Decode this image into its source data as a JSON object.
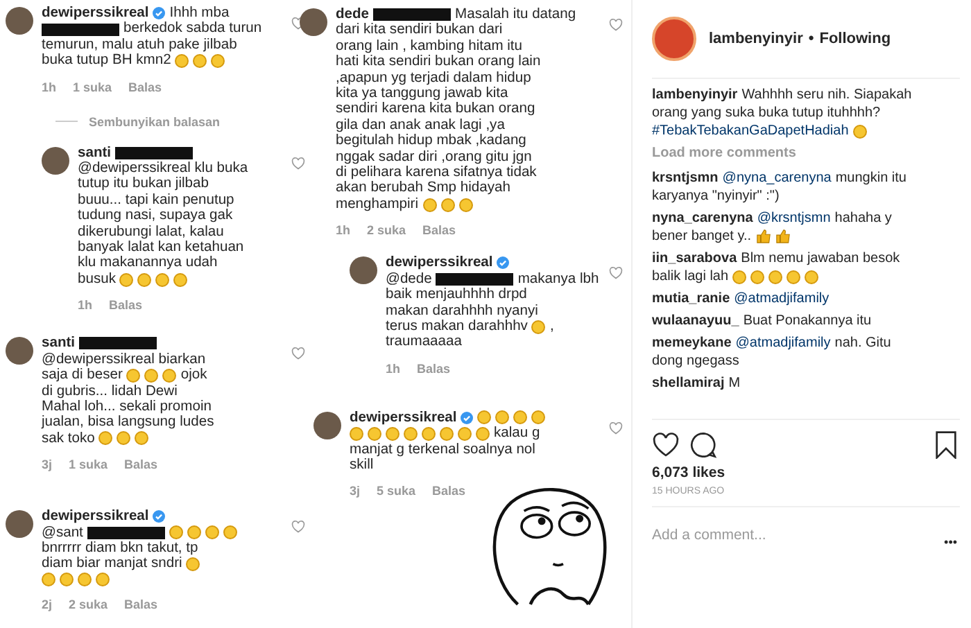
{
  "left_column": {
    "comments": [
      {
        "user": "dewiperssikreal",
        "verified": true,
        "redacted_name": false,
        "head": [
          {
            "kind": "text",
            "text": "Ihhh mba"
          }
        ],
        "lines": [
          [
            {
              "kind": "redacted"
            },
            {
              "kind": "text",
              "text": "berkedok sabda turun"
            }
          ],
          [
            {
              "kind": "text",
              "text": "temurun, malu atuh pake jilbab"
            }
          ],
          [
            {
              "kind": "text",
              "text": "buka tutup BH kmn2"
            },
            {
              "kind": "emoji"
            },
            {
              "kind": "emoji"
            },
            {
              "kind": "emoji"
            }
          ]
        ],
        "time": "1h",
        "likes": "1 suka",
        "reply": "Balas",
        "replies_toggle": "Sembunyikan balasan",
        "children": [
          {
            "user": "santi",
            "verified": false,
            "redacted_name": true,
            "lines": [
              [
                {
                  "kind": "text",
                  "text": "@dewiperssikreal klu buka"
                }
              ],
              [
                {
                  "kind": "text",
                  "text": "tutup itu bukan jilbab"
                }
              ],
              [
                {
                  "kind": "text",
                  "text": "buuu... tapi kain penutup"
                }
              ],
              [
                {
                  "kind": "text",
                  "text": "tudung nasi, supaya gak"
                }
              ],
              [
                {
                  "kind": "text",
                  "text": "dikerubungi lalat, kalau"
                }
              ],
              [
                {
                  "kind": "text",
                  "text": "banyak lalat kan ketahuan"
                }
              ],
              [
                {
                  "kind": "text",
                  "text": "klu makanannya udah"
                }
              ],
              [
                {
                  "kind": "text",
                  "text": "busuk"
                },
                {
                  "kind": "emoji"
                },
                {
                  "kind": "emoji"
                },
                {
                  "kind": "emoji"
                },
                {
                  "kind": "emoji"
                }
              ]
            ],
            "time": "1h",
            "reply": "Balas"
          }
        ]
      },
      {
        "user": "santi",
        "verified": false,
        "redacted_name": true,
        "lines": [
          [
            {
              "kind": "text",
              "text": "@dewiperssikreal biarkan"
            }
          ],
          [
            {
              "kind": "text",
              "text": "saja di beser"
            },
            {
              "kind": "emoji"
            },
            {
              "kind": "emoji"
            },
            {
              "kind": "emoji"
            },
            {
              "kind": "text",
              "text": "ojok"
            }
          ],
          [
            {
              "kind": "text",
              "text": "di gubris... lidah Dewi"
            }
          ],
          [
            {
              "kind": "text",
              "text": "Mahal loh... sekali promoin"
            }
          ],
          [
            {
              "kind": "text",
              "text": "jualan, bisa langsung ludes"
            }
          ],
          [
            {
              "kind": "text",
              "text": "sak toko"
            },
            {
              "kind": "emoji"
            },
            {
              "kind": "emoji"
            },
            {
              "kind": "emoji"
            }
          ]
        ],
        "time": "3j",
        "likes": "1 suka",
        "reply": "Balas"
      },
      {
        "user": "dewiperssikreal",
        "verified": true,
        "redacted_name": false,
        "lines": [
          [
            {
              "kind": "text",
              "text": "@sant"
            },
            {
              "kind": "redacted"
            },
            {
              "kind": "emoji"
            },
            {
              "kind": "emoji"
            },
            {
              "kind": "emoji"
            },
            {
              "kind": "emoji"
            }
          ],
          [
            {
              "kind": "text",
              "text": "bnrrrrr diam bkn takut, tp"
            }
          ],
          [
            {
              "kind": "text",
              "text": "diam biar manjat sndri"
            },
            {
              "kind": "emoji"
            }
          ],
          [
            {
              "kind": "emoji"
            },
            {
              "kind": "emoji"
            },
            {
              "kind": "emoji"
            },
            {
              "kind": "emoji"
            }
          ]
        ],
        "time": "2j",
        "likes": "2 suka",
        "reply": "Balas"
      }
    ]
  },
  "middle_column": {
    "comments": [
      {
        "user": "dede",
        "verified": false,
        "redacted_name": true,
        "head": [
          {
            "kind": "text",
            "text": "Masalah itu datang"
          }
        ],
        "lines": [
          [
            {
              "kind": "text",
              "text": "dari kita sendiri bukan dari"
            }
          ],
          [
            {
              "kind": "text",
              "text": "orang lain , kambing hitam itu"
            }
          ],
          [
            {
              "kind": "text",
              "text": "hati kita sendiri bukan orang lain"
            }
          ],
          [
            {
              "kind": "text",
              "text": ",apapun yg terjadi dalam hidup"
            }
          ],
          [
            {
              "kind": "text",
              "text": "kita ya tanggung jawab kita"
            }
          ],
          [
            {
              "kind": "text",
              "text": "sendiri karena kita bukan orang"
            }
          ],
          [
            {
              "kind": "text",
              "text": "gila dan anak anak lagi ,ya"
            }
          ],
          [
            {
              "kind": "text",
              "text": "begitulah hidup mbak ,kadang"
            }
          ],
          [
            {
              "kind": "text",
              "text": "nggak sadar diri ,orang gitu jgn"
            }
          ],
          [
            {
              "kind": "text",
              "text": "di pelihara karena sifatnya tidak"
            }
          ],
          [
            {
              "kind": "text",
              "text": "akan berubah Smp hidayah"
            }
          ],
          [
            {
              "kind": "text",
              "text": "menghampiri"
            },
            {
              "kind": "emoji"
            },
            {
              "kind": "emoji"
            },
            {
              "kind": "emoji"
            }
          ]
        ],
        "time": "1h",
        "likes": "2 suka",
        "reply": "Balas",
        "children": [
          {
            "user": "dewiperssikreal",
            "verified": true,
            "redacted_name": false,
            "lines": [
              [
                {
                  "kind": "text",
                  "text": "@dede"
                },
                {
                  "kind": "redacted"
                },
                {
                  "kind": "text",
                  "text": "makanya lbh"
                }
              ],
              [
                {
                  "kind": "text",
                  "text": "baik menjauhhhh drpd"
                }
              ],
              [
                {
                  "kind": "text",
                  "text": "makan darahhhh nyanyi"
                }
              ],
              [
                {
                  "kind": "text",
                  "text": "terus makan darahhhv"
                },
                {
                  "kind": "emoji"
                },
                {
                  "kind": "text",
                  "text": ","
                }
              ],
              [
                {
                  "kind": "text",
                  "text": "traumaaaaa"
                }
              ]
            ],
            "time": "1h",
            "reply": "Balas"
          }
        ]
      },
      {
        "user": "dewiperssikreal",
        "verified": true,
        "redacted_name": false,
        "head": [
          {
            "kind": "emoji"
          },
          {
            "kind": "emoji"
          },
          {
            "kind": "emoji"
          },
          {
            "kind": "emoji"
          }
        ],
        "lines": [
          [
            {
              "kind": "emoji"
            },
            {
              "kind": "emoji"
            },
            {
              "kind": "emoji"
            },
            {
              "kind": "emoji"
            },
            {
              "kind": "emoji"
            },
            {
              "kind": "emoji"
            },
            {
              "kind": "emoji"
            },
            {
              "kind": "emoji"
            },
            {
              "kind": "text",
              "text": "kalau g"
            }
          ],
          [
            {
              "kind": "text",
              "text": "manjat g terkenal soalnya nol"
            }
          ],
          [
            {
              "kind": "text",
              "text": "skill"
            }
          ]
        ],
        "time": "3j",
        "likes": "5 suka",
        "reply": "Balas"
      }
    ]
  },
  "post_panel": {
    "header": {
      "user": "lambenyinyir",
      "separator": "•",
      "status": "Following"
    },
    "caption": {
      "user": "lambenyinyir",
      "lines": [
        [
          {
            "kind": "text",
            "text": "Wahhhh seru nih. Siapakah"
          }
        ],
        [
          {
            "kind": "text",
            "text": "orang yang suka buka tutup ituhhhh?"
          }
        ],
        [
          {
            "kind": "hashtag",
            "text": "#TebakTebakanGaDapetHadiah"
          },
          {
            "kind": "emoji"
          }
        ]
      ]
    },
    "load_more": "Load more comments",
    "comments": [
      {
        "user": "krsntjsmn",
        "lines": [
          [
            {
              "kind": "mention",
              "text": "@nyna_carenyna"
            },
            {
              "kind": "text",
              "text": "mungkin itu"
            }
          ],
          [
            {
              "kind": "text",
              "text": "karyanya \"nyinyir\" :\")"
            }
          ]
        ]
      },
      {
        "user": "nyna_carenyna",
        "lines": [
          [
            {
              "kind": "mention",
              "text": "@krsntjsmn"
            },
            {
              "kind": "text",
              "text": "hahaha y"
            }
          ],
          [
            {
              "kind": "text",
              "text": "bener banget y.."
            },
            {
              "kind": "thumbs"
            },
            {
              "kind": "thumbs"
            }
          ]
        ]
      },
      {
        "user": "iin_sarabova",
        "lines": [
          [
            {
              "kind": "text",
              "text": "Blm nemu jawaban besok"
            }
          ],
          [
            {
              "kind": "text",
              "text": "balik lagi lah"
            },
            {
              "kind": "emoji"
            },
            {
              "kind": "emoji"
            },
            {
              "kind": "emoji"
            },
            {
              "kind": "emoji"
            },
            {
              "kind": "emoji"
            }
          ]
        ]
      },
      {
        "user": "mutia_ranie",
        "lines": [
          [
            {
              "kind": "mention",
              "text": "@atmadjifamily"
            }
          ]
        ]
      },
      {
        "user": "wulaanayuu_",
        "lines": [
          [
            {
              "kind": "text",
              "text": "Buat Ponakannya itu"
            }
          ]
        ]
      },
      {
        "user": "memeykane",
        "lines": [
          [
            {
              "kind": "mention",
              "text": "@atmadjifamily"
            },
            {
              "kind": "text",
              "text": "nah. Gitu"
            }
          ],
          [
            {
              "kind": "text",
              "text": "dong ngegass"
            }
          ]
        ]
      },
      {
        "user": "shellamiraj",
        "lines": [
          [
            {
              "kind": "text",
              "text": "M"
            }
          ]
        ]
      }
    ],
    "likes": "6,073 likes",
    "timestamp": "15 HOURS AGO",
    "comment_field": {
      "placeholder": "Add a comment..."
    },
    "more": "•••"
  }
}
